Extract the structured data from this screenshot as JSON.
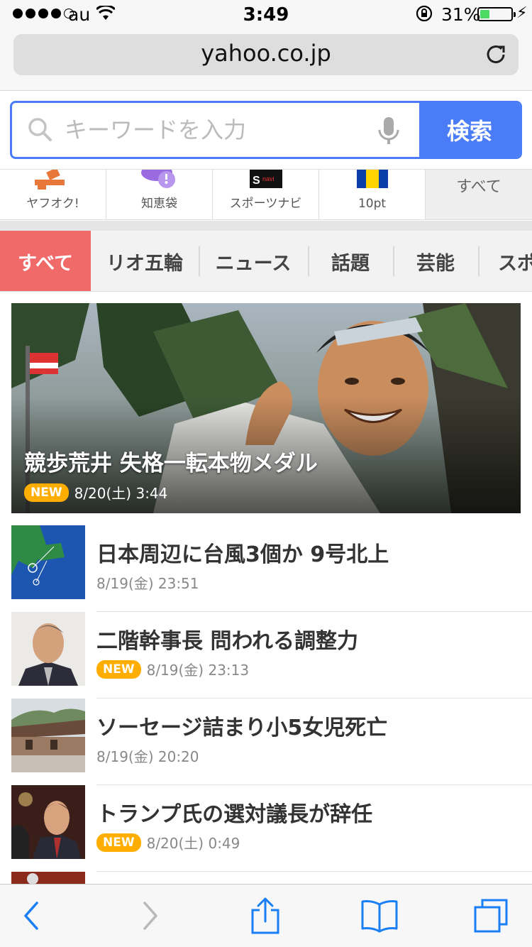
{
  "status_bar": {
    "carrier": "au",
    "time": "3:49",
    "battery_percent": "31%",
    "battery_level": 0.31
  },
  "browser": {
    "url": "yahoo.co.jp"
  },
  "search": {
    "placeholder": "キーワードを入力",
    "button_label": "検索"
  },
  "services": [
    {
      "label": "ヤフオク!",
      "icon": "auction-hammer-icon"
    },
    {
      "label": "知恵袋",
      "icon": "chiebukuro-icon"
    },
    {
      "label": "スポーツナビ",
      "icon": "sportsnavi-icon"
    },
    {
      "label": "10pt",
      "icon": "tpoint-icon"
    },
    {
      "label": "すべて"
    }
  ],
  "tabs": [
    "すべて",
    "リオ五輪",
    "ニュース",
    "話題",
    "芸能",
    "スポ"
  ],
  "top_story": {
    "title": "競歩荒井 失格一転本物メダル",
    "badge": "NEW",
    "date": "8/20(土) 3:44"
  },
  "news": [
    {
      "headline": "日本周辺に台風3個か 9号北上",
      "date": "8/19(金) 23:51",
      "badge": ""
    },
    {
      "headline": "二階幹事長 問われる調整力",
      "date": "8/19(金) 23:13",
      "badge": "NEW"
    },
    {
      "headline": "ソーセージ詰まり小5女児死亡",
      "date": "8/19(金) 20:20",
      "badge": ""
    },
    {
      "headline": "トランプ氏の選対議長が辞任",
      "date": "8/20(土) 0:49",
      "badge": "NEW"
    }
  ],
  "colors": {
    "accent": "#4a7cf7",
    "active_tab": "#f16a6a",
    "new_badge": "#ffae00",
    "ios_blue": "#1a7ff5"
  }
}
